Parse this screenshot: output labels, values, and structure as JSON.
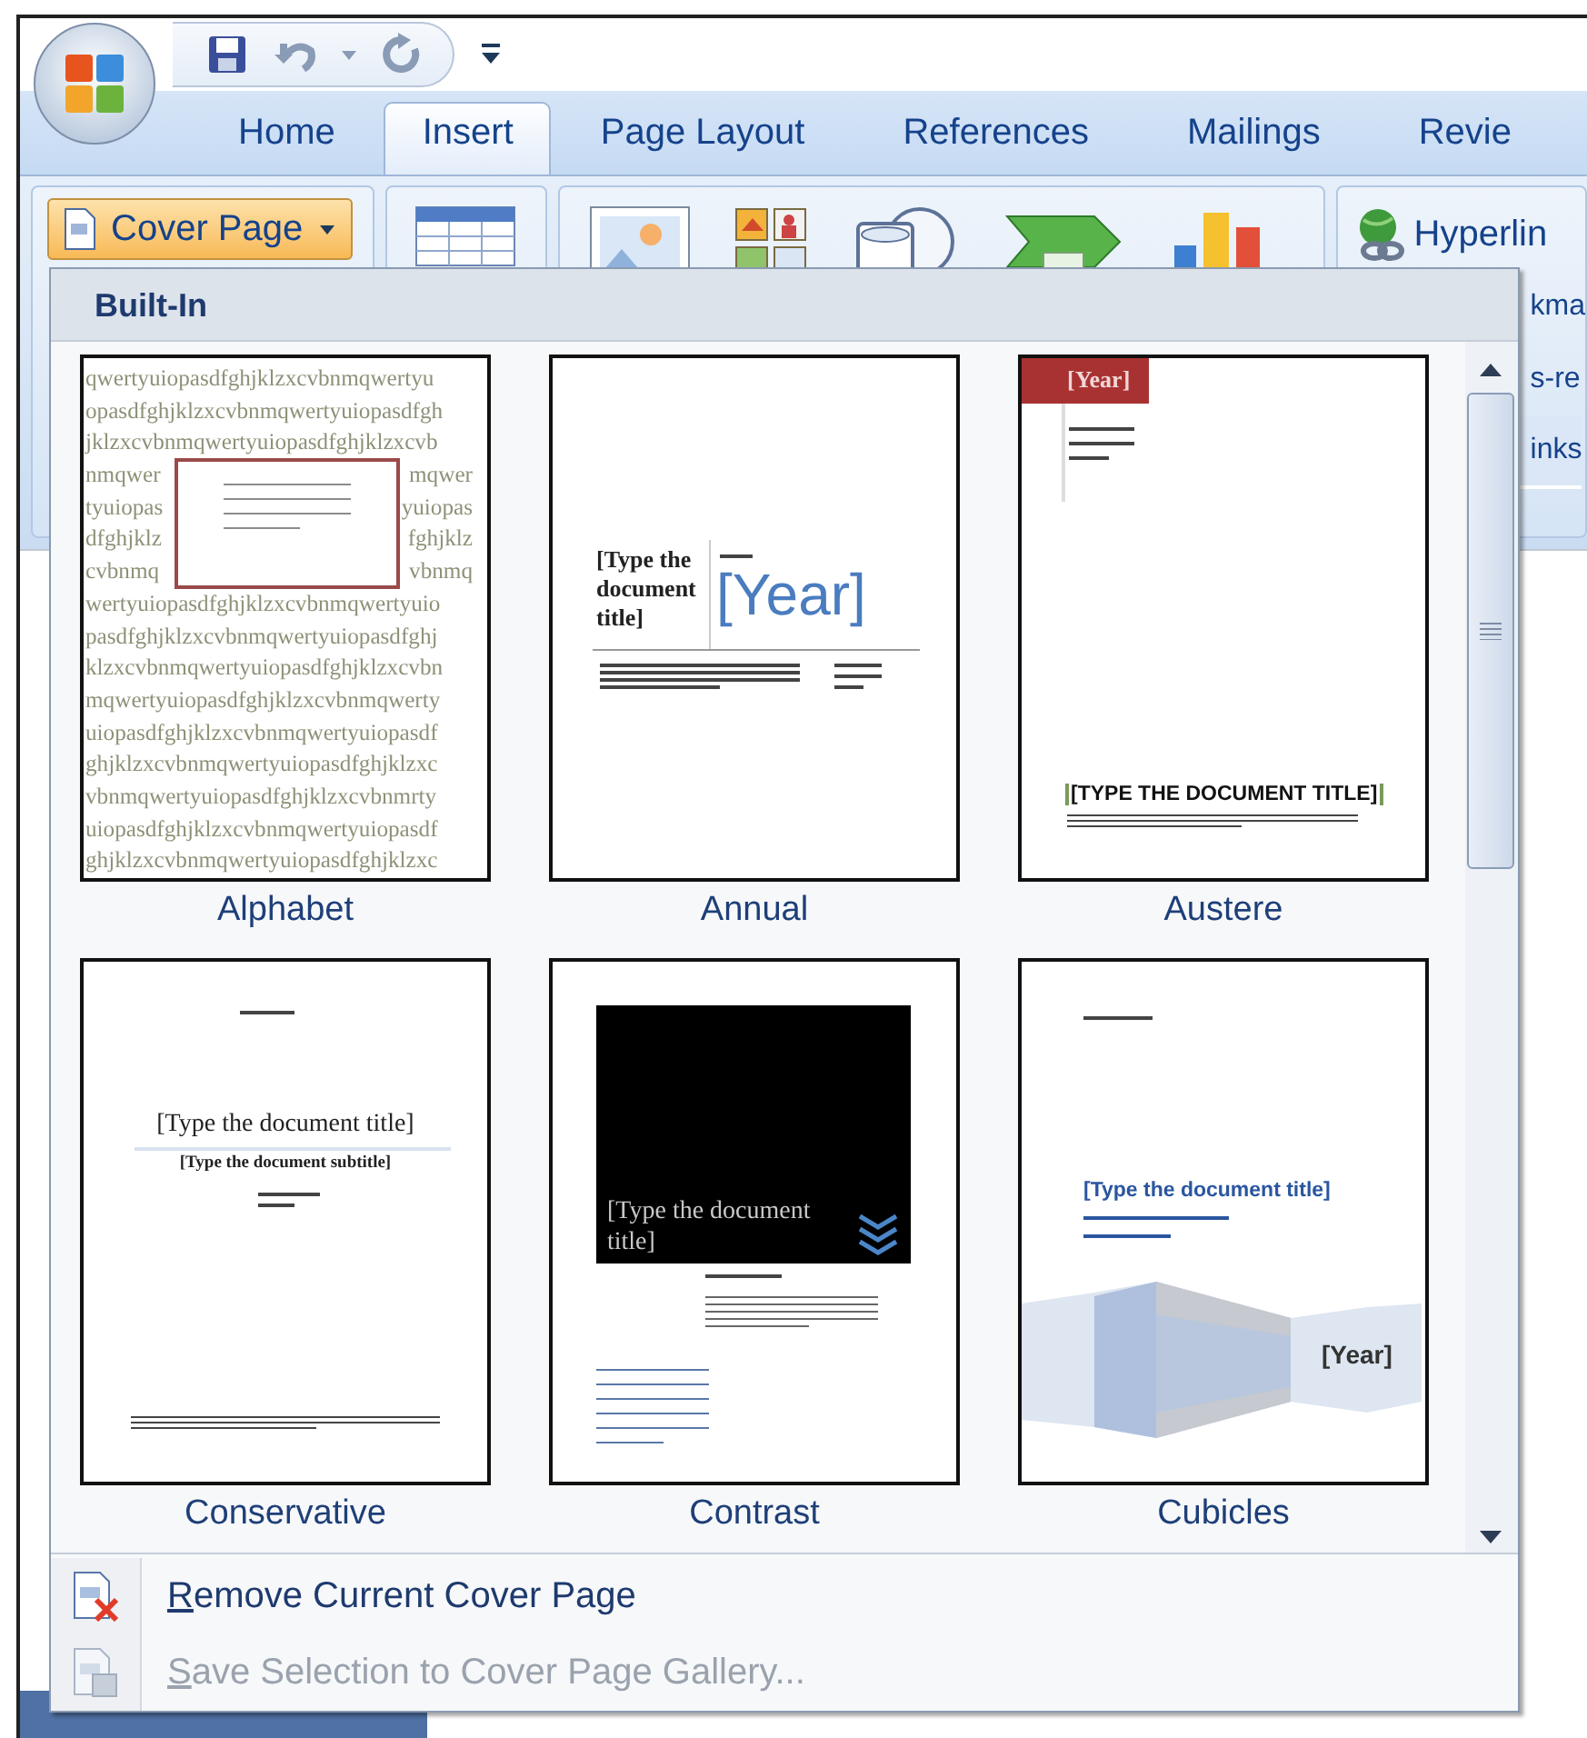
{
  "tabs": [
    {
      "label": "Home",
      "selected": false
    },
    {
      "label": "Insert",
      "selected": true
    },
    {
      "label": "Page Layout",
      "selected": false
    },
    {
      "label": "References",
      "selected": false
    },
    {
      "label": "Mailings",
      "selected": false
    },
    {
      "label": "Revie",
      "selected": false
    }
  ],
  "ribbon": {
    "cover_page_button": {
      "label": "Cover Page",
      "pressed": true
    },
    "links_group": [
      "Hyperlin",
      "kma",
      "s-re",
      "inks"
    ]
  },
  "dropdown": {
    "header": "Built-In",
    "gallery": [
      {
        "name": "Alphabet",
        "kind": "alphabet",
        "rows": [
          [
            "qwertyuiopasdfghjklzxcvbnmqwertyu"
          ],
          [
            "opasdfghjklzxcvbnmqwertyuiopasdfgh"
          ],
          [
            "jklzxcvbnmqwertyuiopasdfghjklzxcvb"
          ],
          [
            "nmqwer",
            "mqwer"
          ],
          [
            "tyuiopas",
            "yuiopas"
          ],
          [
            "dfghjklz",
            "fghjklz"
          ],
          [
            "cvbnmq",
            "vbnmq"
          ],
          [
            "wertyuiopasdfghjklzxcvbnmqwertyuio"
          ],
          [
            "pasdfghjklzxcvbnmqwertyuiopasdfghj"
          ],
          [
            "klzxcvbnmqwertyuiopasdfghjklzxcvbn"
          ],
          [
            "mqwertyuiopasdfghjklzxcvbnmqwerty"
          ],
          [
            "uiopasdfghjklzxcvbnmqwertyuiopasdf"
          ],
          [
            "ghjklzxcvbnmqwertyuiopasdfghjklzxc"
          ],
          [
            "vbnmqwertyuiopasdfghjklzxcvbnmrty"
          ],
          [
            "uiopasdfghjklzxcvbnmqwertyuiopasdf"
          ],
          [
            "ghjklzxcvbnmqwertyuiopasdfghjklzxc"
          ]
        ]
      },
      {
        "name": "Annual",
        "kind": "annual",
        "title": "[Type the document title]",
        "year": "[Year]"
      },
      {
        "name": "Austere",
        "kind": "austere",
        "year": "[Year]",
        "title": "[TYPE THE DOCUMENT TITLE]"
      },
      {
        "name": "Conservative",
        "kind": "conservative",
        "title": "[Type the document title]",
        "subtitle": "[Type the document subtitle]"
      },
      {
        "name": "Contrast",
        "kind": "contrast",
        "title": "[Type the document title]"
      },
      {
        "name": "Cubicles",
        "kind": "cubicles",
        "title": "[Type the document title]",
        "year": "[Year]"
      }
    ],
    "menu": [
      {
        "label": "Remove Current Cover Page",
        "access_key_underlined": true,
        "disabled": false,
        "kind": "remove"
      },
      {
        "label": "Save Selection to Cover Page Gallery...",
        "access_key_underlined": true,
        "disabled": true,
        "kind": "save"
      }
    ]
  }
}
